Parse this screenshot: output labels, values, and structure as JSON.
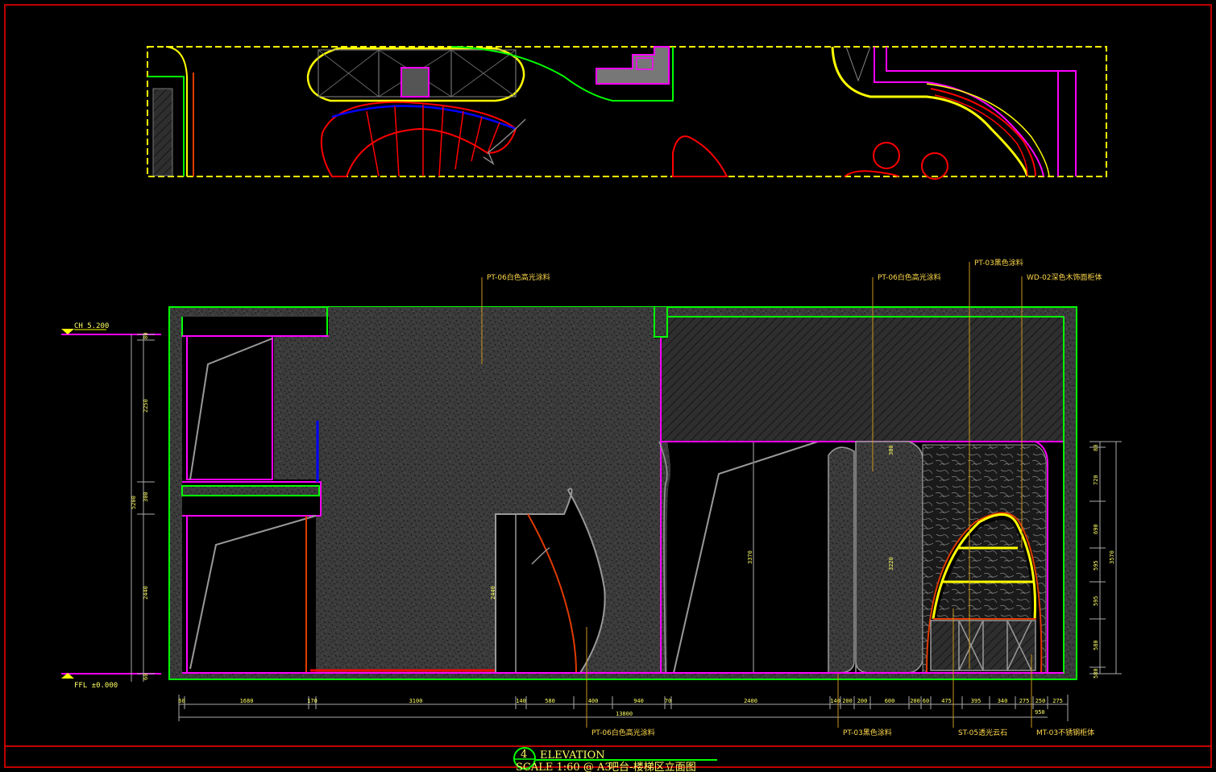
{
  "drawing": {
    "title_number": "4",
    "title_en": "ELEVATION",
    "title_scale": "SCALE 1:60 @ A3",
    "title_cn": "吧台-楼梯区立面图"
  },
  "levels": {
    "top": "CH 5.200",
    "bottom": "FFL ±0.000"
  },
  "callouts": {
    "pt06_left": "PT-06白色高光涂料",
    "pt06_right": "PT-06白色高光涂料",
    "pt03_top": "PT-03黑色涂料",
    "wd02": "WD-02深色木饰面柜体",
    "pt06_bottom": "PT-06白色高光涂料",
    "pt03_bottom": "PT-03黑色涂料",
    "st05": "ST-05透光云石",
    "mt03": "MT-03不锈钢柜体"
  },
  "dims": {
    "bottom_segments": [
      "60",
      "1680",
      "170",
      "3100",
      "140",
      "580",
      "400",
      "940",
      "70",
      "2400",
      "140",
      "200",
      "200",
      "600",
      "200",
      "60",
      "475",
      "395",
      "340",
      "275",
      "250",
      "275"
    ],
    "bottom_total": "13800",
    "bottom_sub": "950",
    "left_segments": [
      "80",
      "2250",
      "300",
      "5200",
      "2440",
      "60"
    ],
    "right_segments": [
      "80",
      "720",
      "690",
      "595",
      "595",
      "580",
      "580",
      "3570",
      "60"
    ],
    "inner_a": "2440",
    "inner_b": "3370",
    "inner_c": "300",
    "inner_d": "3220"
  },
  "colors": {
    "frame": "#ff0000",
    "wall": "#00ff00",
    "ceiling": "#ff00ff",
    "plan": "#ffff00",
    "leader": "#c8961e",
    "texture": "#3a3a3a"
  }
}
